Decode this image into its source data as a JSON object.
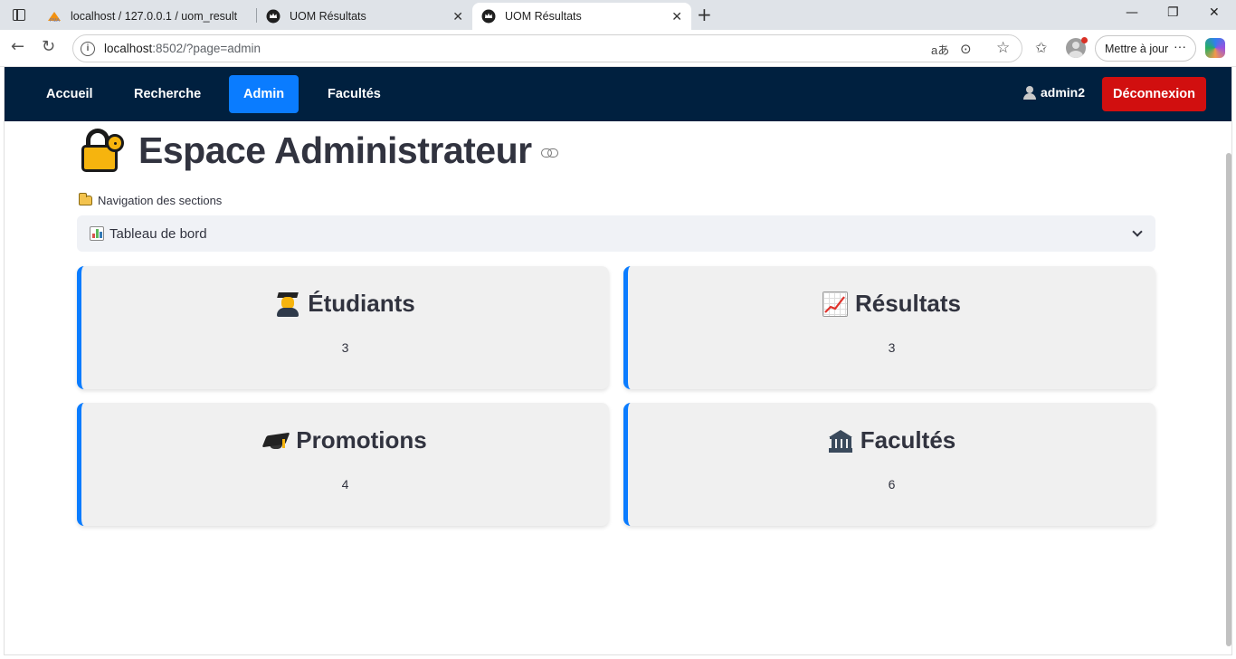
{
  "browser": {
    "tabs": [
      {
        "title": "localhost / 127.0.0.1 / uom_result",
        "favicon": "phpmyadmin-icon"
      },
      {
        "title": "UOM Résultats",
        "favicon": "crown-icon"
      },
      {
        "title": "UOM Résultats",
        "favicon": "crown-icon",
        "active": true
      }
    ],
    "url_host": "localhost",
    "url_path": ":8502/?page=admin",
    "update_label": "Mettre à jour"
  },
  "navbar": {
    "items": [
      {
        "label": "Accueil"
      },
      {
        "label": "Recherche"
      },
      {
        "label": "Admin",
        "active": true
      },
      {
        "label": "Facultés"
      }
    ],
    "user": "admin2",
    "logout_label": "Déconnexion",
    "bg_color": "#00203f",
    "active_color": "#0a7cff",
    "logout_color": "#d10f0f"
  },
  "page": {
    "title": "Espace Administrateur",
    "section_label": "Navigation des sections",
    "select_value": "Tableau de bord"
  },
  "cards": [
    {
      "label": "Étudiants",
      "value": "3",
      "icon": "student-icon"
    },
    {
      "label": "Résultats",
      "value": "3",
      "icon": "chart-increasing-icon"
    },
    {
      "label": "Promotions",
      "value": "4",
      "icon": "graduation-cap-icon"
    },
    {
      "label": "Facultés",
      "value": "6",
      "icon": "classical-building-icon"
    }
  ]
}
